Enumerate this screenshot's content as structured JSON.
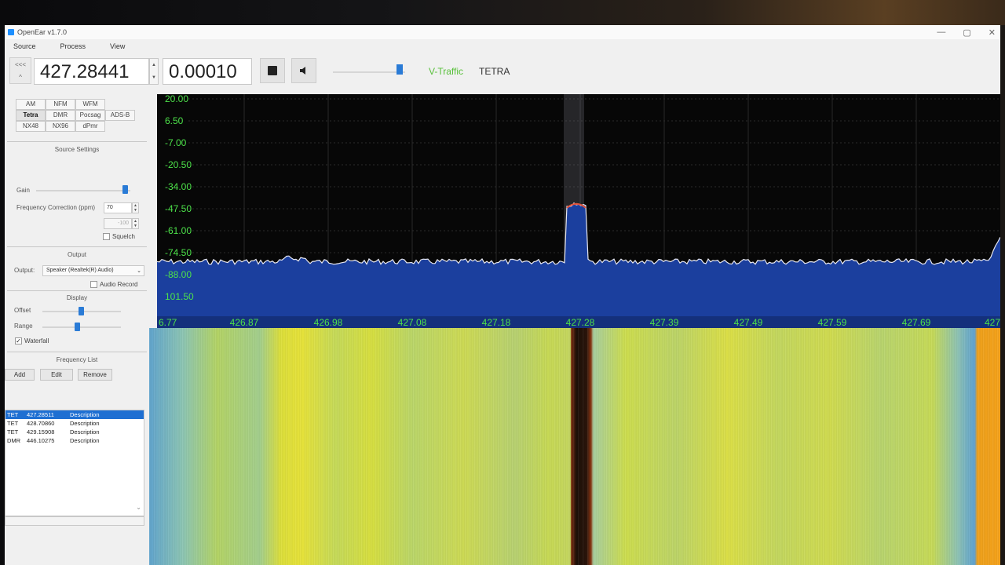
{
  "window": {
    "title": "OpenEar v1.7.0",
    "controls": [
      "—",
      "▢",
      "✕"
    ]
  },
  "menu": [
    "Source",
    "Process",
    "View"
  ],
  "toolbar": {
    "nav_label": "<<<",
    "frequency": "427.28441",
    "step": "0.00010",
    "volume_level_pct": 92,
    "protocol": "V-Traffic",
    "system": "TETRA",
    "accent_color": "#2a7bd6",
    "protocol_color": "#58c03a"
  },
  "modes": [
    [
      {
        "label": "AM",
        "active": false
      },
      {
        "label": "NFM",
        "active": false
      },
      {
        "label": "WFM",
        "active": false
      }
    ],
    [
      {
        "label": "Tetra",
        "active": true
      },
      {
        "label": "DMR",
        "active": false
      },
      {
        "label": "Pocsag",
        "active": false
      },
      {
        "label": "ADS-B",
        "active": false
      }
    ],
    [
      {
        "label": "NX48",
        "active": false
      },
      {
        "label": "NX96",
        "active": false
      },
      {
        "label": "dPmr",
        "active": false
      }
    ]
  ],
  "source_settings": {
    "title": "Source Settings",
    "gain_label": "Gain",
    "gain_level_pct": 95,
    "freq_corr_label": "Frequency Correction (ppm)",
    "freq_corr_value": "70",
    "squelch_value": "-100",
    "squelch_label": "Squelch",
    "squelch_checked": false
  },
  "output": {
    "title": "Output",
    "label": "Output:",
    "device": "Speaker (Realtek(R) Audio)",
    "audio_record_label": "Audio Record",
    "audio_record_checked": false
  },
  "display": {
    "title": "Display",
    "offset_label": "Offset",
    "offset_level_pct": 50,
    "range_label": "Range",
    "range_level_pct": 45,
    "waterfall_label": "Waterfall",
    "waterfall_checked": true
  },
  "frequency_list": {
    "title": "Frequency List",
    "add_label": "Add",
    "edit_label": "Edit",
    "remove_label": "Remove",
    "rows": [
      {
        "type": "TET",
        "freq": "427.28511",
        "desc": "Description",
        "selected": true
      },
      {
        "type": "TET",
        "freq": "428.70860",
        "desc": "Description",
        "selected": false
      },
      {
        "type": "TET",
        "freq": "429.15908",
        "desc": "Description",
        "selected": false
      },
      {
        "type": "DMR",
        "freq": "446.10275",
        "desc": "Description",
        "selected": false
      }
    ]
  },
  "spectrum": {
    "y_ticks": [
      "20.00",
      "6.50",
      "-7.00",
      "-20.50",
      "-34.00",
      "-47.50",
      "-61.00",
      "-74.50",
      "-88.00",
      "101.50"
    ],
    "x_ticks": [
      "6.77",
      "426.87",
      "426.98",
      "427.08",
      "427.18",
      "427.28",
      "427.39",
      "427.49",
      "427.59",
      "427.69",
      "427"
    ],
    "noise_floor_db": -80,
    "peak_freq": "427.28",
    "peak_db": -45,
    "trace_color": "#e8e8f0",
    "fill_color": "#1b3f9e",
    "label_color": "#4de14a"
  }
}
